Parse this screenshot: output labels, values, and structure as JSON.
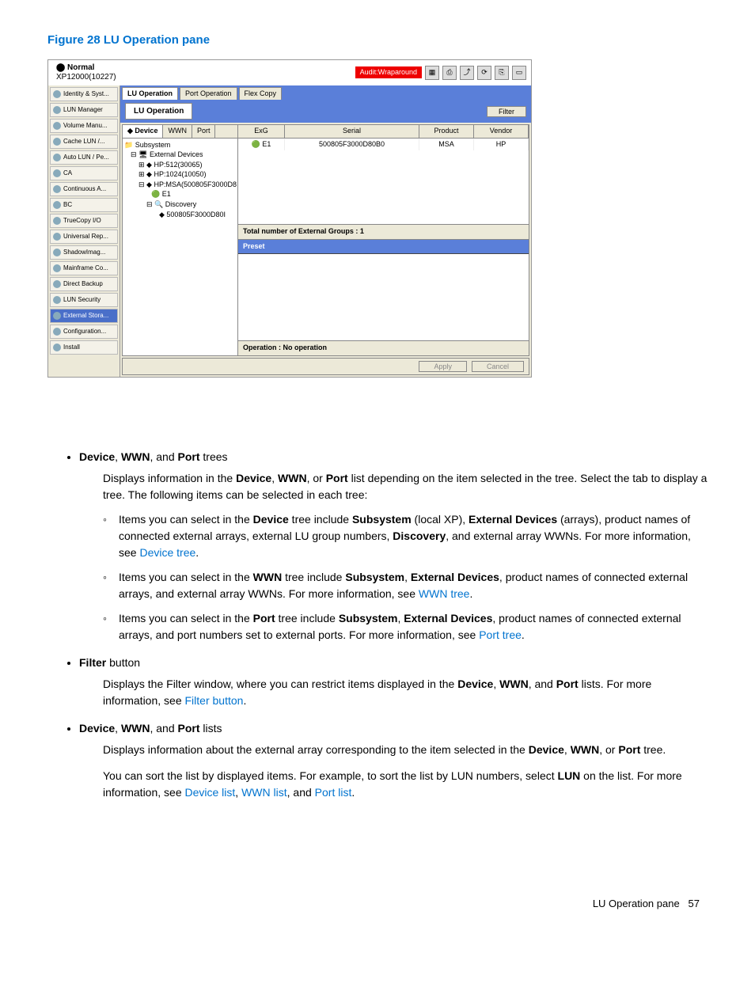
{
  "figure_title": "Figure 28 LU Operation pane",
  "topbar": {
    "status": "Normal",
    "device": "XP12000(10227)",
    "audit": "Audit:Wraparound"
  },
  "sidebar": [
    "Identity & Syst...",
    "LUN Manager",
    "Volume Manu...",
    "Cache LUN /...",
    "Auto LUN / Pe...",
    "CA",
    "Continuous A...",
    "BC",
    "TrueCopy I/O",
    "Universal Rep...",
    "ShadowImag...",
    "Mainframe Co...",
    "Direct Backup",
    "LUN Security",
    "External Stora...",
    "Configuration...",
    "Install"
  ],
  "sidebar_active_index": 14,
  "main_tabs": [
    "LU Operation",
    "Port Operation",
    "Flex Copy"
  ],
  "main_tab_active": 0,
  "lu_title": "LU Operation",
  "filter_label": "Filter",
  "tree_tabs": [
    "Device",
    "WWN",
    "Port"
  ],
  "tree_tab_active": 0,
  "tree": {
    "root": "Subsystem",
    "ext": "External Devices",
    "n1": "HP:512(30065)",
    "n2": "HP:1024(10050)",
    "n3": "HP:MSA(500805F3000D8",
    "n3a": "E1",
    "n3b": "Discovery",
    "n3b1": "500805F3000D80I"
  },
  "table": {
    "headers": [
      "ExG",
      "Serial",
      "Product",
      "Vendor"
    ],
    "row": [
      "E1",
      "500805F3000D80B0",
      "MSA",
      "HP"
    ]
  },
  "total_groups_label": "Total number of External Groups : 1",
  "preset_label": "Preset",
  "operation_label": "Operation : No operation",
  "apply_label": "Apply",
  "cancel_label": "Cancel",
  "doc": {
    "li1_head": "Device, WWN, and Port trees",
    "li1_desc": "Displays information in the Device, WWN, or Port list depending on the item selected in the tree. Select the tab to display a tree. The following items can be selected in each tree:",
    "sub1": "Items you can select in the Device tree include Subsystem (local XP), External Devices (arrays), product names of connected external arrays, external LU group numbers, Discovery, and external array WWNs. For more information, see ",
    "sub1_link": "Device tree",
    "sub2": "Items you can select in the WWN tree include Subsystem, External Devices, product names of connected external arrays, and external array WWNs. For more information, see ",
    "sub2_link": "WWN tree",
    "sub3": "Items you can select in the Port tree include Subsystem, External Devices, product names of connected external arrays, and port numbers set to external ports. For more information, see ",
    "sub3_link": "Port tree",
    "li2_head": "Filter button",
    "li2_desc_pre": "Displays the Filter window, where you can restrict items displayed in the Device, WWN, and Port lists. For more information, see ",
    "li2_link": "Filter button",
    "li3_head": "Device, WWN, and Port lists",
    "li3_desc": "Displays information about the external array corresponding to the item selected in the Device, WWN, or Port tree.",
    "li3_desc2_pre": "You can sort the list by displayed items. For example, to sort the list by LUN numbers, select LUN on the list. For more information, see ",
    "li3_link1": "Device list",
    "li3_link2": "WWN list",
    "li3_link3": "Port list"
  },
  "footer_text": "LU Operation pane",
  "footer_page": "57"
}
